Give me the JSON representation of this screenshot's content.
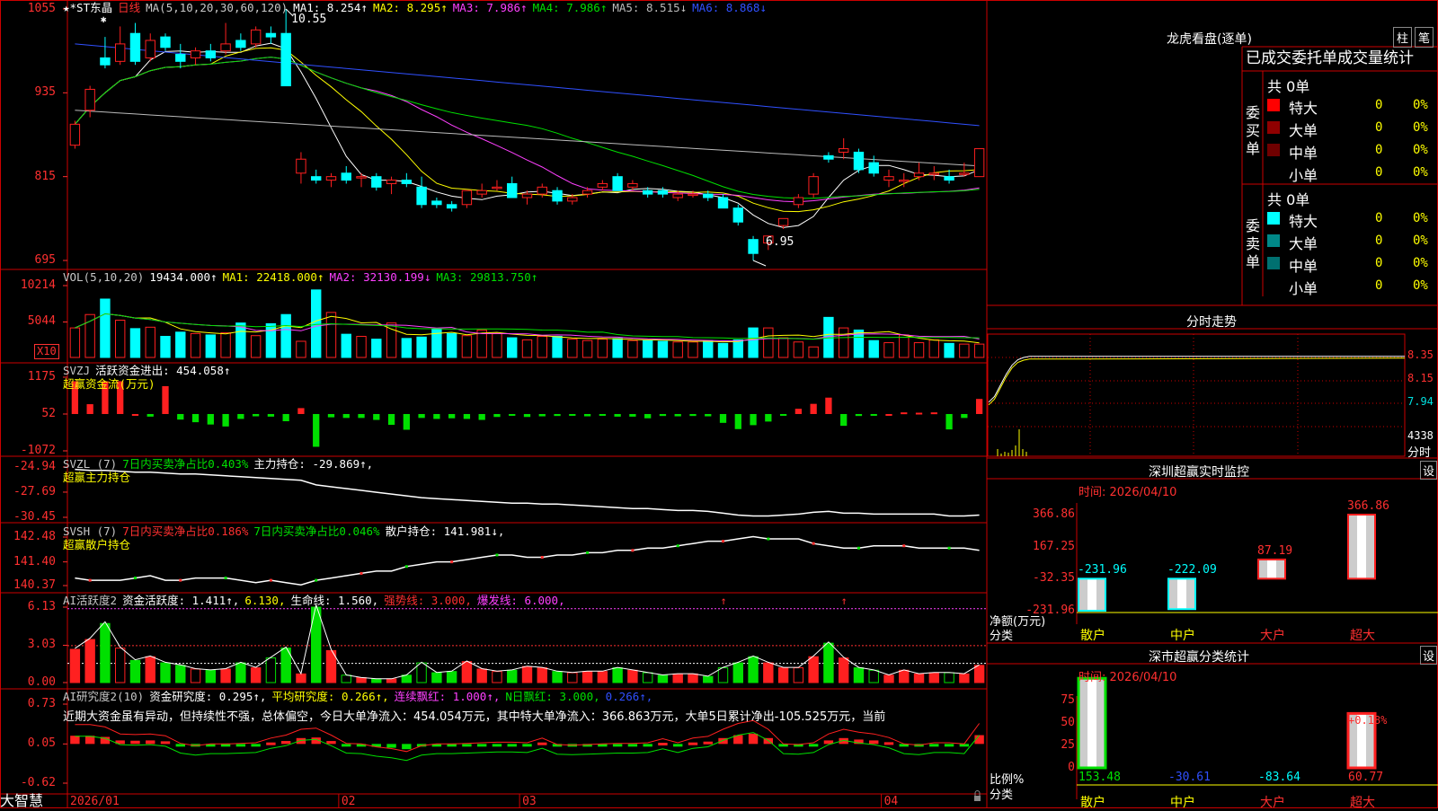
{
  "app": {
    "brand": "大智慧",
    "lock_icon": "lock-icon"
  },
  "main_chart": {
    "header": [
      {
        "t": "★*ST东晶",
        "c": "#ffffff"
      },
      {
        "t": "日线",
        "c": "#ff3030"
      },
      {
        "t": "MA(5,10,20,30,60,120)",
        "c": "#c8c8c8"
      },
      {
        "t": "MA1: 8.254↑",
        "c": "#ffffff"
      },
      {
        "t": "MA2: 8.295↑",
        "c": "#ffff00"
      },
      {
        "t": "MA3: 7.986↑",
        "c": "#ff40ff"
      },
      {
        "t": "MA4: 7.986↑",
        "c": "#00e000"
      },
      {
        "t": "MA5: 8.515↓",
        "c": "#bbbbbb"
      },
      {
        "t": "MA6: 8.868↓",
        "c": "#3050ff"
      }
    ],
    "y_ticks": [
      "1055",
      "935",
      "815",
      "695"
    ],
    "high_label": "10.55",
    "low_label": "6.95",
    "marker": "✱"
  },
  "volume_panel": {
    "header": [
      {
        "t": "VOL(5,10,20)",
        "c": "#c8c8c8"
      },
      {
        "t": "19434.000↑",
        "c": "#ffffff"
      },
      {
        "t": "MA1: 22418.000↑",
        "c": "#ffff00"
      },
      {
        "t": "MA2: 32130.199↓",
        "c": "#ff40ff"
      },
      {
        "t": "MA3: 29813.750↑",
        "c": "#00e000"
      }
    ],
    "y_ticks": [
      "10214",
      "5044"
    ],
    "unit": "X10"
  },
  "svzj_panel": {
    "header": [
      {
        "t": "SVZJ",
        "c": "#c8c8c8"
      },
      {
        "t": "活跃资金进出: 454.058↑",
        "c": "#ffffff"
      }
    ],
    "subtitle": "超赢资金流(万元)",
    "y_ticks": [
      "1175",
      "52",
      "-1072"
    ]
  },
  "svzl_panel": {
    "header": [
      {
        "t": "SVZL (7)",
        "c": "#c8c8c8"
      },
      {
        "t": "7日内买卖净占比0.403%",
        "c": "#00e000"
      },
      {
        "t": "主力持仓: -29.869↑,",
        "c": "#ffffff"
      }
    ],
    "subtitle": "超赢主力持仓",
    "y_ticks": [
      "-24.94",
      "-27.69",
      "-30.45"
    ]
  },
  "svsh_panel": {
    "header": [
      {
        "t": "SVSH (7)",
        "c": "#c8c8c8"
      },
      {
        "t": "7日内买卖净占比0.186%",
        "c": "#ff3030"
      },
      {
        "t": "7日内买卖净占比0.046%",
        "c": "#00e000"
      },
      {
        "t": "散户持仓: 141.981↓,",
        "c": "#ffffff"
      }
    ],
    "subtitle": "超赢散户持仓",
    "y_ticks": [
      "142.48",
      "141.40",
      "140.37"
    ]
  },
  "activity_panel": {
    "header": [
      {
        "t": "AI活跃度2",
        "c": "#c8c8c8"
      },
      {
        "t": "资金活跃度: 1.411↑,",
        "c": "#ffffff"
      },
      {
        "t": "6.130,",
        "c": "#ffff00"
      },
      {
        "t": "生命线: 1.560,",
        "c": "#ffffff"
      },
      {
        "t": "强势线: 3.000,",
        "c": "#ff3030"
      },
      {
        "t": "爆发线: 6.000,",
        "c": "#ff40ff"
      }
    ],
    "y_ticks": [
      "6.13",
      "3.03",
      "0.00"
    ]
  },
  "research_panel": {
    "header": [
      {
        "t": "AI研究度2(10)",
        "c": "#c8c8c8"
      },
      {
        "t": "资金研究度: 0.295↑,",
        "c": "#ffffff"
      },
      {
        "t": "平均研究度: 0.266↑,",
        "c": "#ffff00"
      },
      {
        "t": "连续飘红: 1.000↑,",
        "c": "#ff40ff"
      },
      {
        "t": "N日飘红: 3.000,",
        "c": "#00e000"
      },
      {
        "t": "0.266↑,",
        "c": "#3050ff"
      }
    ],
    "commentary": "近期大资金虽有异动，但持续性不强，总体偏空，今日大单净流入：454.054万元，其中特大单净流入：366.863万元，大单5日累计净出-105.525万元，当前",
    "y_ticks": [
      "0.73",
      "0.05",
      "-0.62"
    ]
  },
  "date_axis": [
    "2026/01",
    "02",
    "03",
    "04"
  ],
  "right_panel": {
    "dragon": {
      "title": "龙虎看盘(逐单)",
      "btn_col": "柱",
      "btn_tick": "笔",
      "tab_title": "已成交委托单成交量统计",
      "buy": {
        "label": "委买单",
        "total": "共 0单",
        "rows": [
          {
            "name": "特大",
            "count": "0",
            "pct": "0%",
            "color": "#ff0000"
          },
          {
            "name": "大单",
            "count": "0",
            "pct": "0%",
            "color": "#900000"
          },
          {
            "name": "中单",
            "count": "0",
            "pct": "0%",
            "color": "#700000"
          },
          {
            "name": "小单",
            "count": "0",
            "pct": "0%",
            "color": ""
          }
        ]
      },
      "sell": {
        "label": "委卖单",
        "total": "共 0单",
        "rows": [
          {
            "name": "特大",
            "count": "0",
            "pct": "0%",
            "color": "#00ffff"
          },
          {
            "name": "大单",
            "count": "0",
            "pct": "0%",
            "color": "#008888"
          },
          {
            "name": "中单",
            "count": "0",
            "pct": "0%",
            "color": "#007070"
          },
          {
            "name": "小单",
            "count": "0",
            "pct": "0%",
            "color": ""
          }
        ]
      }
    },
    "intraday": {
      "title": "分时走势",
      "y_ticks": [
        "8.35",
        "8.15",
        "7.94"
      ],
      "vol_label": "4338",
      "unit_label": "分时"
    },
    "sz_monitor": {
      "title": "深圳超赢实时监控",
      "btn": "设",
      "date": "时间: 2026/04/10",
      "y_ticks": [
        "366.86",
        "167.25",
        "-32.35",
        "-231.96"
      ],
      "y_unit": "净额(万元)",
      "x_caption": "分类",
      "categories": [
        "散户",
        "中户",
        "大户",
        "超大"
      ],
      "values": [
        -231.96,
        -222.09,
        87.19,
        366.86
      ],
      "value_labels": [
        "-231.96",
        "-222.09",
        "87.19",
        "366.86"
      ]
    },
    "sz_classify": {
      "title": "深市超赢分类统计",
      "btn": "设",
      "date": "时间: 2026/04/10",
      "y_ticks": [
        "75",
        "50",
        "25",
        "0"
      ],
      "y_unit": "比例%",
      "x_caption": "分类",
      "categories": [
        "散户",
        "中户",
        "大户",
        "超大"
      ],
      "values": [
        153.48,
        -30.61,
        -83.64,
        60.77
      ],
      "value_labels": [
        "153.48",
        "-30.61",
        "-83.64",
        "60.77"
      ],
      "bar_note": "+0.18%"
    }
  },
  "colors": {
    "up": "#ff2020",
    "down": "#00ffff",
    "grid": "#cc0000",
    "axis_text": "#ff3030"
  },
  "chart_data": [
    {
      "type": "candlestick",
      "title": "★*ST东晶 日线",
      "x_label_months": [
        "2026/01",
        "02",
        "03",
        "04"
      ],
      "ylim": [
        6.95,
        10.55
      ],
      "ohlc": [
        [
          8.6,
          8.95,
          8.55,
          8.9
        ],
        [
          9.1,
          9.45,
          9.0,
          9.4
        ],
        [
          9.85,
          10.15,
          9.7,
          9.75
        ],
        [
          9.8,
          10.3,
          9.75,
          10.05
        ],
        [
          10.2,
          10.35,
          9.75,
          9.8
        ],
        [
          9.85,
          10.2,
          9.8,
          10.1
        ],
        [
          10.15,
          10.2,
          9.95,
          10.0
        ],
        [
          9.9,
          10.05,
          9.7,
          9.8
        ],
        [
          9.85,
          10.0,
          9.75,
          9.95
        ],
        [
          9.95,
          10.05,
          9.8,
          9.85
        ],
        [
          9.95,
          10.35,
          9.9,
          10.05
        ],
        [
          10.1,
          10.2,
          9.95,
          10.0
        ],
        [
          10.05,
          10.3,
          10.0,
          10.25
        ],
        [
          10.2,
          10.3,
          10.05,
          10.15
        ],
        [
          10.2,
          10.55,
          9.45,
          9.45
        ],
        [
          8.2,
          8.5,
          8.05,
          8.4
        ],
        [
          8.15,
          8.25,
          8.05,
          8.1
        ],
        [
          8.1,
          8.2,
          8.0,
          8.15
        ],
        [
          8.2,
          8.3,
          8.05,
          8.1
        ],
        [
          8.15,
          8.2,
          8.0,
          8.15
        ],
        [
          8.15,
          8.2,
          7.95,
          8.0
        ],
        [
          8.05,
          8.15,
          7.9,
          8.1
        ],
        [
          8.1,
          8.2,
          8.0,
          8.05
        ],
        [
          8.0,
          8.15,
          7.7,
          7.75
        ],
        [
          7.8,
          7.85,
          7.7,
          7.75
        ],
        [
          7.75,
          7.8,
          7.65,
          7.7
        ],
        [
          7.75,
          7.95,
          7.7,
          7.95
        ],
        [
          7.9,
          8.05,
          7.85,
          7.95
        ],
        [
          8.0,
          8.1,
          7.95,
          8.0
        ],
        [
          8.05,
          8.15,
          7.85,
          7.85
        ],
        [
          7.85,
          7.95,
          7.75,
          7.9
        ],
        [
          7.9,
          8.05,
          7.85,
          8.0
        ],
        [
          7.95,
          8.0,
          7.75,
          7.8
        ],
        [
          7.8,
          7.9,
          7.75,
          7.85
        ],
        [
          7.9,
          8.0,
          7.85,
          7.95
        ],
        [
          8.0,
          8.1,
          7.95,
          8.05
        ],
        [
          8.15,
          8.2,
          7.95,
          7.95
        ],
        [
          8.0,
          8.1,
          7.95,
          8.05
        ],
        [
          7.95,
          8.0,
          7.85,
          7.9
        ],
        [
          7.95,
          8.0,
          7.85,
          7.9
        ],
        [
          7.85,
          7.95,
          7.8,
          7.9
        ],
        [
          7.9,
          7.95,
          7.85,
          7.9
        ],
        [
          7.9,
          7.95,
          7.8,
          7.85
        ],
        [
          7.85,
          7.9,
          7.7,
          7.7
        ],
        [
          7.7,
          7.75,
          7.45,
          7.5
        ],
        [
          7.25,
          7.3,
          6.95,
          7.05
        ],
        [
          7.2,
          7.3,
          7.1,
          7.3
        ],
        [
          7.45,
          7.55,
          7.4,
          7.55
        ],
        [
          7.75,
          7.9,
          7.7,
          7.85
        ],
        [
          7.9,
          8.2,
          7.85,
          8.15
        ],
        [
          8.45,
          8.5,
          8.35,
          8.4
        ],
        [
          8.5,
          8.7,
          8.4,
          8.55
        ],
        [
          8.5,
          8.55,
          8.2,
          8.25
        ],
        [
          8.35,
          8.45,
          8.15,
          8.2
        ],
        [
          8.1,
          8.25,
          8.0,
          8.15
        ],
        [
          8.1,
          8.2,
          8.0,
          8.1
        ],
        [
          8.15,
          8.35,
          8.1,
          8.2
        ],
        [
          8.2,
          8.3,
          8.1,
          8.2
        ],
        [
          8.15,
          8.25,
          8.05,
          8.1
        ],
        [
          8.2,
          8.35,
          8.15,
          8.2
        ],
        [
          8.15,
          8.55,
          8.15,
          8.55
        ]
      ]
    },
    {
      "type": "bar",
      "title": "VOL(5,10,20)",
      "ylim": [
        0,
        10214
      ],
      "values": [
        4200,
        6100,
        8300,
        5300,
        4100,
        4300,
        3000,
        3600,
        3400,
        3200,
        3500,
        4900,
        3100,
        4800,
        6100,
        2300,
        9600,
        6400,
        3300,
        3000,
        2600,
        4900,
        2700,
        2900,
        4000,
        3400,
        3100,
        3900,
        3400,
        2800,
        2500,
        3000,
        3000,
        2600,
        2400,
        2600,
        2700,
        2400,
        2400,
        2300,
        2200,
        2200,
        2400,
        2000,
        2500,
        4200,
        4200,
        2800,
        2200,
        1500,
        5700,
        4200,
        3900,
        2400,
        2100,
        3200,
        2100,
        2500,
        2000,
        1900,
        1900
      ]
    },
    {
      "type": "bar",
      "title": "SVZJ 活跃资金进出",
      "ylim": [
        -1072,
        1175
      ],
      "values": [
        1000,
        300,
        1000,
        1000,
        0,
        -80,
        850,
        -170,
        -250,
        -320,
        -380,
        -150,
        -70,
        -80,
        -220,
        180,
        -1000,
        -100,
        -120,
        -120,
        -180,
        -330,
        -480,
        -120,
        -150,
        -130,
        -150,
        -180,
        -90,
        -20,
        -90,
        -70,
        -60,
        -50,
        -70,
        -50,
        -80,
        -80,
        -130,
        -60,
        -70,
        -60,
        -70,
        -270,
        -460,
        -340,
        -230,
        -20,
        160,
        310,
        500,
        -360,
        -60,
        -40,
        0,
        50,
        40,
        50,
        -470,
        -120,
        460
      ]
    },
    {
      "type": "line",
      "title": "SVZL 主力持仓",
      "ylim": [
        -30.45,
        -24.94
      ],
      "values": [
        -25.2,
        -25.3,
        -25.3,
        -25.4,
        -25.5,
        -25.5,
        -25.6,
        -25.7,
        -25.7,
        -25.8,
        -25.9,
        -26.0,
        -26.1,
        -26.2,
        -26.3,
        -26.4,
        -26.9,
        -27.1,
        -27.3,
        -27.5,
        -27.7,
        -27.9,
        -28.1,
        -28.3,
        -28.4,
        -28.5,
        -28.6,
        -28.7,
        -28.8,
        -28.9,
        -28.9,
        -29.0,
        -29.0,
        -29.1,
        -29.2,
        -29.3,
        -29.4,
        -29.5,
        -29.5,
        -29.6,
        -29.7,
        -29.7,
        -29.8,
        -30.0,
        -30.2,
        -30.3,
        -30.3,
        -30.2,
        -30.1,
        -29.9,
        -29.8,
        -30.0,
        -30.0,
        -30.1,
        -30.1,
        -30.1,
        -30.1,
        -30.1,
        -30.3,
        -30.3,
        -30.2
      ]
    },
    {
      "type": "line",
      "title": "SVSH 散户持仓",
      "ylim": [
        140.37,
        142.48
      ],
      "values": [
        140.7,
        140.6,
        140.6,
        140.6,
        140.7,
        140.8,
        140.6,
        140.6,
        140.7,
        140.7,
        140.7,
        140.6,
        140.5,
        140.6,
        140.5,
        140.4,
        140.6,
        140.7,
        140.8,
        140.9,
        141.0,
        141.0,
        141.2,
        141.3,
        141.4,
        141.4,
        141.5,
        141.6,
        141.7,
        141.7,
        141.6,
        141.6,
        141.7,
        141.7,
        141.8,
        141.8,
        141.9,
        141.9,
        142.0,
        142.0,
        142.1,
        142.2,
        142.3,
        142.3,
        142.4,
        142.5,
        142.4,
        142.4,
        142.4,
        142.2,
        142.1,
        142.0,
        142.0,
        142.1,
        142.1,
        142.1,
        142.0,
        142.0,
        142.0,
        142.0,
        141.9
      ]
    },
    {
      "type": "bar",
      "title": "AI活跃度2",
      "ylim": [
        0,
        6.13
      ],
      "lines": {
        "生命线": 1.56,
        "强势线": 3.0,
        "爆发线": 6.0
      },
      "values": [
        2.7,
        3.5,
        4.8,
        2.8,
        1.8,
        2.1,
        1.6,
        1.4,
        1.1,
        1.0,
        1.1,
        1.6,
        1.2,
        2.0,
        2.8,
        0.7,
        6.13,
        2.6,
        0.6,
        0.4,
        0.3,
        0.3,
        0.6,
        1.6,
        0.8,
        0.9,
        1.7,
        1.1,
        0.9,
        1.0,
        1.3,
        1.2,
        0.9,
        0.8,
        0.9,
        0.9,
        1.2,
        1.0,
        0.8,
        0.6,
        0.7,
        0.7,
        0.5,
        1.2,
        1.6,
        2.1,
        1.6,
        1.2,
        1.2,
        2.1,
        3.2,
        2.0,
        1.2,
        1.0,
        0.6,
        1.0,
        0.7,
        0.8,
        0.8,
        0.7,
        1.4
      ]
    },
    {
      "type": "bar",
      "title": "AI研究度2(10)",
      "ylim": [
        -0.62,
        0.73
      ],
      "values": [
        0.28,
        0.28,
        0.24,
        0.12,
        0.11,
        0.12,
        0.09,
        -0.04,
        -0.08,
        -0.05,
        -0.05,
        -0.04,
        -0.03,
        0.05,
        0.1,
        0.2,
        0.22,
        0.1,
        -0.04,
        -0.05,
        -0.1,
        -0.13,
        -0.18,
        -0.08,
        -0.05,
        -0.05,
        -0.04,
        -0.03,
        -0.02,
        -0.02,
        -0.03,
        0.05,
        -0.06,
        -0.07,
        -0.06,
        -0.05,
        -0.04,
        -0.04,
        -0.03,
        0.04,
        -0.03,
        0.05,
        0.08,
        0.2,
        0.3,
        0.35,
        0.2,
        -0.05,
        -0.06,
        -0.03,
        0.12,
        0.2,
        0.15,
        0.12,
        0.06,
        -0.05,
        -0.07,
        -0.03,
        -0.03,
        -0.05,
        0.3
      ]
    },
    {
      "type": "line",
      "title": "分时走势",
      "ylim": [
        7.94,
        8.35
      ],
      "values": [
        7.95,
        8.0,
        8.1,
        8.2,
        8.28,
        8.33,
        8.35,
        8.36,
        8.36,
        8.36,
        8.36,
        8.36,
        8.36,
        8.36,
        8.36,
        8.36
      ]
    },
    {
      "type": "bar",
      "title": "深圳超赢实时监控",
      "categories": [
        "散户",
        "中户",
        "大户",
        "超大"
      ],
      "values": [
        -231.96,
        -222.09,
        87.19,
        366.86
      ],
      "ylim": [
        -231.96,
        366.86
      ],
      "ylabel": "净额(万元)",
      "xlabel": "分类"
    },
    {
      "type": "bar",
      "title": "深市超赢分类统计",
      "categories": [
        "散户",
        "中户",
        "大户",
        "超大"
      ],
      "values": [
        153.48,
        -30.61,
        -83.64,
        60.77
      ],
      "ylim": [
        0,
        75
      ],
      "ylabel": "比例%",
      "xlabel": "分类"
    }
  ]
}
